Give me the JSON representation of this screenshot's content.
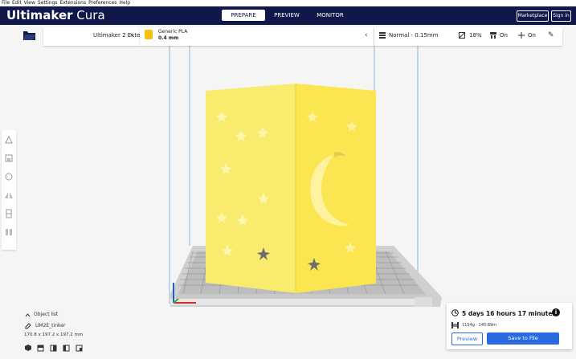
{
  "menu": [
    "File",
    "Edit",
    "View",
    "Settings",
    "Extensions",
    "Preferences",
    "Help"
  ],
  "app": {
    "brand_bold": "Ultimaker",
    "brand_light": " Cura"
  },
  "stages": [
    {
      "label": "PREPARE",
      "active": true
    },
    {
      "label": "PREVIEW",
      "active": false
    },
    {
      "label": "MONITOR",
      "active": false
    }
  ],
  "header_buttons": {
    "marketplace": "Marketplace",
    "signin": "Sign in"
  },
  "printer": {
    "name": "Ultimaker 2 Extended+"
  },
  "material": {
    "name": "Generic PLA",
    "nozzle": "0.4 mm"
  },
  "print_settings": {
    "profile": "Normal - 0.15mm",
    "infill": "18%",
    "support": "On",
    "adhesion": "On"
  },
  "object": {
    "list_label": "Object list",
    "name": "UM2E_tinker",
    "dimensions": "170.8 x 197.2 x 197.2 mm"
  },
  "estimate": {
    "time": "5 days 16 hours 17 minutes",
    "usage": "1154g · 145.89m"
  },
  "actions": {
    "preview": "Preview",
    "save": "Save to File"
  },
  "colors": {
    "header": "#10184b",
    "accent": "#2a6ae0",
    "model": "#f9eb6e",
    "material": "#f2c20f"
  }
}
